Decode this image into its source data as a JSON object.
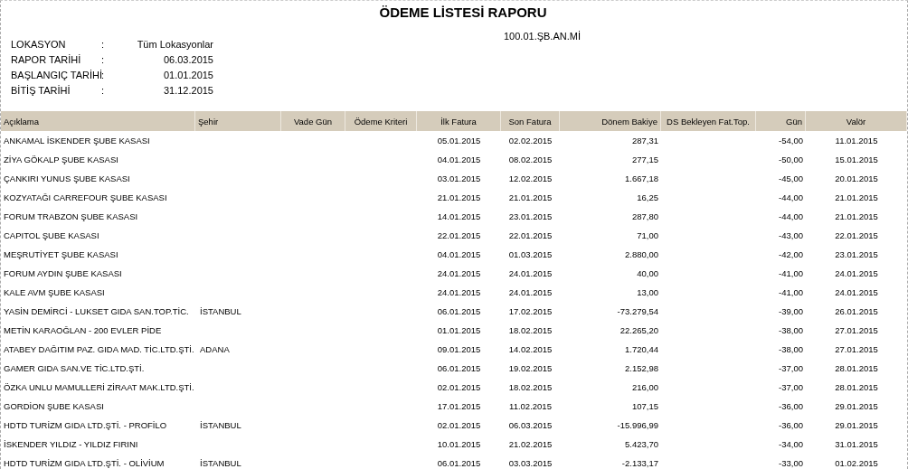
{
  "title": "ÖDEME LİSTESİ RAPORU",
  "info": [
    {
      "label": "LOKASYON",
      "sep": ":",
      "value": "Tüm Lokasyonlar"
    },
    {
      "label": "RAPOR TARİHİ",
      "sep": ":",
      "value": "06.03.2015"
    },
    {
      "label": "BAŞLANGIÇ TARİHİ",
      "sep": ":",
      "value": "01.01.2015"
    },
    {
      "label": "BİTİŞ TARİHİ",
      "sep": ":",
      "value": "31.12.2015"
    }
  ],
  "account_code": "100.01.ŞB.AN.Mİ",
  "table": {
    "columns": [
      "Açıklama",
      "Şehir",
      "Vade Gün",
      "Ödeme Kriteri",
      "İlk Fatura",
      "Son Fatura",
      "Dönem Bakiye",
      "DS Bekleyen Fat.Top.",
      "Gün",
      "Valör"
    ],
    "rows": [
      {
        "aciklama": "ANKAMAL İSKENDER ŞUBE KASASI",
        "ilk_fatura": "05.01.2015",
        "son_fatura": "02.02.2015",
        "donem_bakiye": "287,31",
        "gun": "-54,00",
        "valor": "11.01.2015"
      },
      {
        "aciklama": "ZİYA GÖKALP ŞUBE KASASI",
        "ilk_fatura": "04.01.2015",
        "son_fatura": "08.02.2015",
        "donem_bakiye": "277,15",
        "gun": "-50,00",
        "valor": "15.01.2015"
      },
      {
        "aciklama": "ÇANKIRI YUNUS  ŞUBE KASASI",
        "ilk_fatura": "03.01.2015",
        "son_fatura": "12.02.2015",
        "donem_bakiye": "1.667,18",
        "gun": "-45,00",
        "valor": "20.01.2015"
      },
      {
        "aciklama": "KOZYATAĞI CARREFOUR ŞUBE KASASI",
        "ilk_fatura": "21.01.2015",
        "son_fatura": "21.01.2015",
        "donem_bakiye": "16,25",
        "gun": "-44,00",
        "valor": "21.01.2015"
      },
      {
        "aciklama": "FORUM TRABZON  ŞUBE KASASI",
        "ilk_fatura": "14.01.2015",
        "son_fatura": "23.01.2015",
        "donem_bakiye": "287,80",
        "gun": "-44,00",
        "valor": "21.01.2015"
      },
      {
        "aciklama": "CAPITOL  ŞUBE KASASI",
        "ilk_fatura": "22.01.2015",
        "son_fatura": "22.01.2015",
        "donem_bakiye": "71,00",
        "gun": "-43,00",
        "valor": "22.01.2015"
      },
      {
        "aciklama": "MEŞRUTİYET ŞUBE KASASI",
        "ilk_fatura": "04.01.2015",
        "son_fatura": "01.03.2015",
        "donem_bakiye": "2.880,00",
        "gun": "-42,00",
        "valor": "23.01.2015"
      },
      {
        "aciklama": "FORUM AYDIN  ŞUBE KASASI",
        "ilk_fatura": "24.01.2015",
        "son_fatura": "24.01.2015",
        "donem_bakiye": "40,00",
        "gun": "-41,00",
        "valor": "24.01.2015"
      },
      {
        "aciklama": "KALE AVM ŞUBE KASASI",
        "ilk_fatura": "24.01.2015",
        "son_fatura": "24.01.2015",
        "donem_bakiye": "13,00",
        "gun": "-41,00",
        "valor": "24.01.2015"
      },
      {
        "aciklama": "YASİN DEMİRCİ - LUKSET GIDA SAN.TOP.TİC.",
        "sehir": "İSTANBUL",
        "ilk_fatura": "06.01.2015",
        "son_fatura": "17.02.2015",
        "donem_bakiye": "-73.279,54",
        "gun": "-39,00",
        "valor": "26.01.2015"
      },
      {
        "aciklama": "METİN KARAOĞLAN - 200 EVLER PİDE",
        "ilk_fatura": "01.01.2015",
        "son_fatura": "18.02.2015",
        "donem_bakiye": "22.265,20",
        "gun": "-38,00",
        "valor": "27.01.2015"
      },
      {
        "aciklama": "ATABEY DAĞITIM PAZ. GIDA MAD. TİC.LTD.ŞTİ.",
        "sehir": "ADANA",
        "ilk_fatura": "09.01.2015",
        "son_fatura": "14.02.2015",
        "donem_bakiye": "1.720,44",
        "gun": "-38,00",
        "valor": "27.01.2015"
      },
      {
        "aciklama": "GAMER GIDA SAN.VE TİC.LTD.ŞTİ.",
        "ilk_fatura": "06.01.2015",
        "son_fatura": "19.02.2015",
        "donem_bakiye": "2.152,98",
        "gun": "-37,00",
        "valor": "28.01.2015"
      },
      {
        "aciklama": "ÖZKA UNLU MAMULLERİ ZİRAAT MAK.LTD.ŞTİ.",
        "ilk_fatura": "02.01.2015",
        "son_fatura": "18.02.2015",
        "donem_bakiye": "216,00",
        "gun": "-37,00",
        "valor": "28.01.2015"
      },
      {
        "aciklama": "GORDİON ŞUBE KASASI",
        "ilk_fatura": "17.01.2015",
        "son_fatura": "11.02.2015",
        "donem_bakiye": "107,15",
        "gun": "-36,00",
        "valor": "29.01.2015"
      },
      {
        "aciklama": "HDTD TURİZM GIDA LTD.ŞTİ. - PROFİLO",
        "sehir": "İSTANBUL",
        "ilk_fatura": "02.01.2015",
        "son_fatura": "06.03.2015",
        "donem_bakiye": "-15.996,99",
        "gun": "-36,00",
        "valor": "29.01.2015"
      },
      {
        "aciklama": "İSKENDER YILDIZ - YILDIZ FIRINI",
        "ilk_fatura": "10.01.2015",
        "son_fatura": "21.02.2015",
        "donem_bakiye": "5.423,70",
        "gun": "-34,00",
        "valor": "31.01.2015"
      },
      {
        "aciklama": "HDTD TURİZM GIDA LTD.ŞTİ. - OLİVİUM",
        "sehir": "İSTANBUL",
        "ilk_fatura": "06.01.2015",
        "son_fatura": "03.03.2015",
        "donem_bakiye": "-2.133,17",
        "gun": "-33,00",
        "valor": "01.02.2015"
      }
    ]
  }
}
